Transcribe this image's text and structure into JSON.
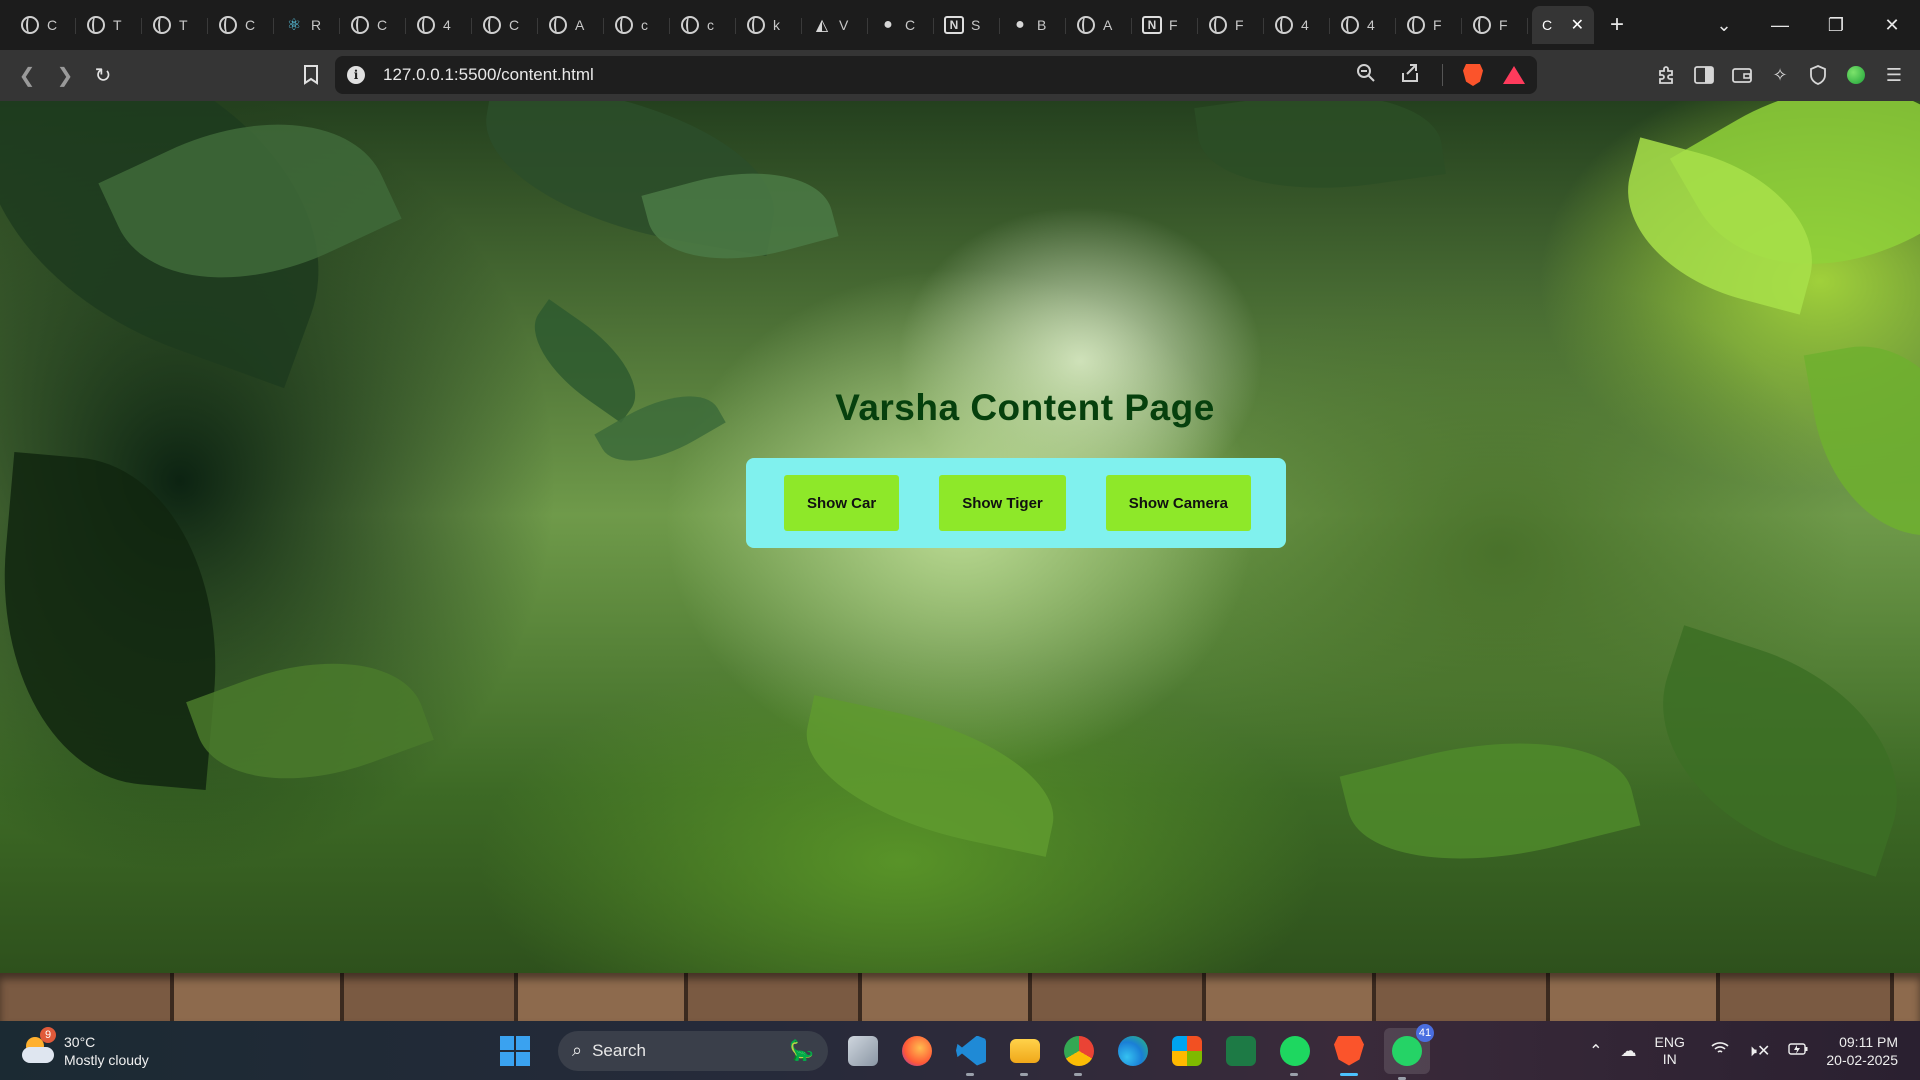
{
  "browser": {
    "tabs": [
      {
        "icon": "globe-icon",
        "label": "C"
      },
      {
        "icon": "globe-icon",
        "label": "T"
      },
      {
        "icon": "globe-icon",
        "label": "T"
      },
      {
        "icon": "globe-icon",
        "label": "C"
      },
      {
        "icon": "react-icon",
        "label": "R"
      },
      {
        "icon": "globe-icon",
        "label": "C"
      },
      {
        "icon": "globe-icon",
        "label": "4"
      },
      {
        "icon": "globe-icon",
        "label": "C"
      },
      {
        "icon": "globe-icon",
        "label": "A"
      },
      {
        "icon": "globe-icon",
        "label": "c"
      },
      {
        "icon": "globe-icon",
        "label": "c"
      },
      {
        "icon": "globe-icon",
        "label": "k"
      },
      {
        "icon": "vercel-icon",
        "label": "V"
      },
      {
        "icon": "github-icon",
        "label": "C"
      },
      {
        "icon": "notion-icon",
        "label": "S"
      },
      {
        "icon": "github-icon",
        "label": "B"
      },
      {
        "icon": "globe-icon",
        "label": "A"
      },
      {
        "icon": "notion-icon",
        "label": "F"
      },
      {
        "icon": "globe-icon",
        "label": "F"
      },
      {
        "icon": "globe-icon",
        "label": "4"
      },
      {
        "icon": "globe-icon",
        "label": "4"
      },
      {
        "icon": "globe-icon",
        "label": "F"
      },
      {
        "icon": "globe-icon",
        "label": "F"
      }
    ],
    "active_tab": {
      "label": "C",
      "close_icon": "close-icon"
    },
    "url": "127.0.0.1:5500/content.html"
  },
  "page": {
    "title": "Varsha Content Page",
    "buttons": {
      "car": "Show Car",
      "tiger": "Show Tiger",
      "camera": "Show Camera"
    },
    "colors": {
      "title": "#06400d",
      "panel": "#80f1ee",
      "button": "#8ee829"
    }
  },
  "taskbar": {
    "weather": {
      "badge": "9",
      "temp": "30°C",
      "condition": "Mostly cloudy"
    },
    "search_label": "Search",
    "whatsapp_badge": "41",
    "language": {
      "line1": "ENG",
      "line2": "IN"
    },
    "clock": {
      "time": "09:11 PM",
      "date": "20-02-2025"
    }
  }
}
